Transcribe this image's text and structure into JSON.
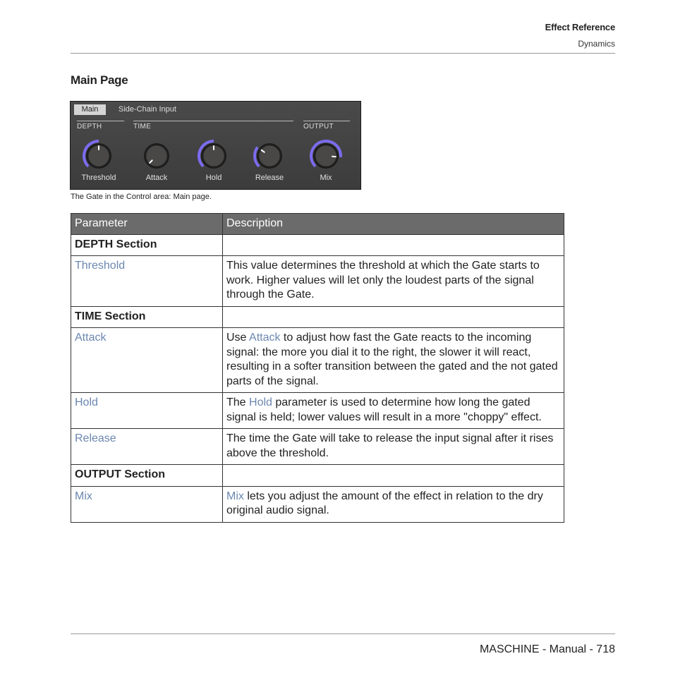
{
  "header": {
    "title": "Effect Reference",
    "subtitle": "Dynamics"
  },
  "page_title": "Main Page",
  "panel": {
    "tabs": [
      {
        "label": "Main",
        "active": true
      },
      {
        "label": "Side-Chain Input",
        "active": false
      }
    ],
    "sections": [
      "DEPTH",
      "TIME",
      "OUTPUT"
    ],
    "accent_color": "#7b6cf0",
    "knobs": [
      {
        "label": "Threshold",
        "value": 0.5
      },
      {
        "label": "Attack",
        "value": 0.0
      },
      {
        "label": "Hold",
        "value": 0.5
      },
      {
        "label": "Release",
        "value": 0.3
      },
      {
        "label": "Mix",
        "value": 0.85
      }
    ]
  },
  "caption": "The Gate in the Control area: Main page.",
  "table": {
    "headers": [
      "Parameter",
      "Description"
    ],
    "rows": [
      {
        "type": "section",
        "param": "DEPTH Section",
        "desc": ""
      },
      {
        "type": "param",
        "param": "Threshold",
        "desc": [
          {
            "t": "This value determines the threshold at which the Gate starts to work. Higher values will let only the loudest parts of the signal through the Gate."
          }
        ]
      },
      {
        "type": "section",
        "param": "TIME Section",
        "desc": ""
      },
      {
        "type": "param",
        "param": "Attack",
        "desc": [
          {
            "t": "Use "
          },
          {
            "t": "Attack",
            "link": true
          },
          {
            "t": " to adjust how fast the Gate reacts to the incoming signal: the more you dial it to the right, the slower it will react, resulting in a softer transition between the gated and the not gated parts of the signal."
          }
        ]
      },
      {
        "type": "param",
        "param": "Hold",
        "desc": [
          {
            "t": "The "
          },
          {
            "t": "Hold",
            "link": true
          },
          {
            "t": " parameter is used to determine how long the gated signal is held; lower values will result in a more \"choppy\" effect."
          }
        ]
      },
      {
        "type": "param",
        "param": "Release",
        "desc": [
          {
            "t": "The time the Gate will take to release the input signal after it rises above the threshold."
          }
        ]
      },
      {
        "type": "section",
        "param": "OUTPUT Section",
        "desc": ""
      },
      {
        "type": "param",
        "param": "Mix",
        "desc": [
          {
            "t": "Mix",
            "link": true
          },
          {
            "t": " lets you adjust the amount of the effect in relation to the dry original audio signal."
          }
        ]
      }
    ]
  },
  "footer": "MASCHINE - Manual - 718"
}
